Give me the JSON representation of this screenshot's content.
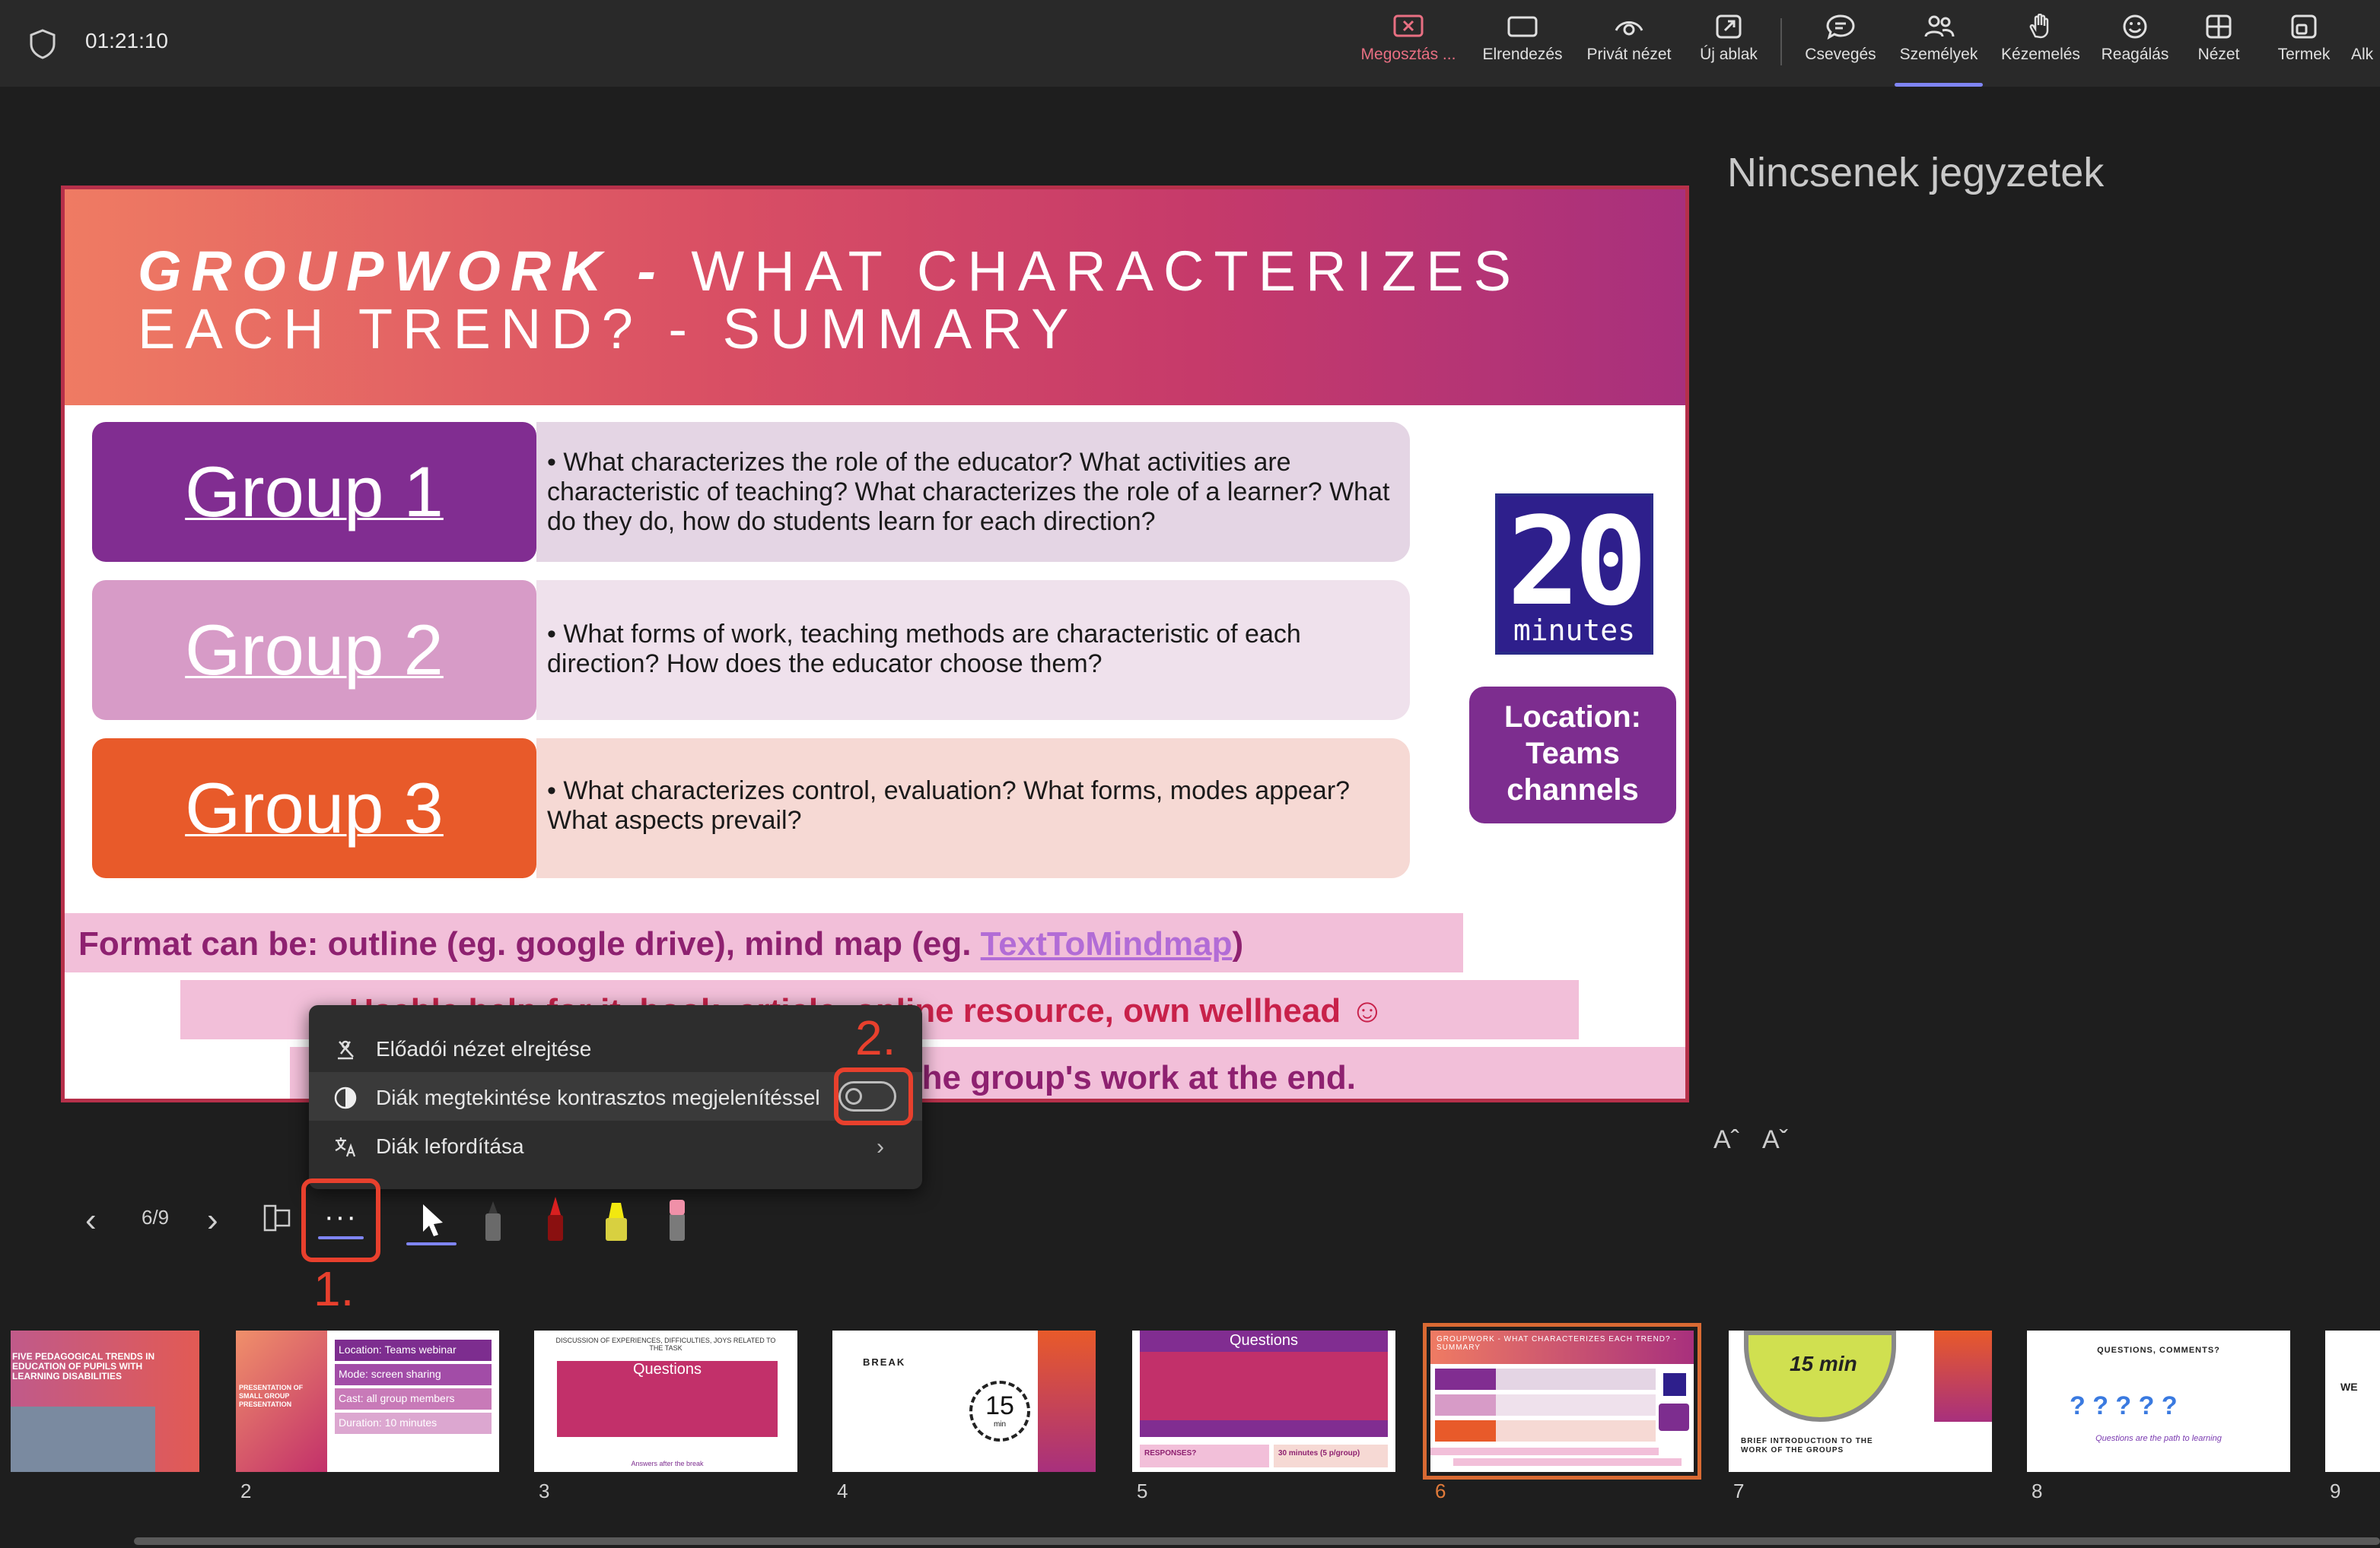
{
  "topbar": {
    "timer": "01:21:10",
    "items": [
      {
        "label": "Megosztás ..."
      },
      {
        "label": "Elrendezés"
      },
      {
        "label": "Privát nézet"
      },
      {
        "label": "Új ablak"
      },
      {
        "label": "Csevegés"
      },
      {
        "label": "Személyek"
      },
      {
        "label": "Kézemelés"
      },
      {
        "label": "Reagálás"
      },
      {
        "label": "Nézet"
      },
      {
        "label": "Termek"
      },
      {
        "label": "Alk"
      }
    ],
    "accent_color": "#7f85f5",
    "share_color": "#e86f82"
  },
  "slide": {
    "title_bold": "GROUPWORK -",
    "title_rest_line1": " WHAT CHARACTERIZES",
    "title_line2": "EACH TREND? - SUMMARY",
    "groups": [
      {
        "name": "Group 1",
        "text": "What characterizes the role of the educator? What activities are characteristic of teaching? What characterizes the role of a learner? What do they do, how do students learn for each direction?",
        "color": "#812d91",
        "bg": "#e4d5e4"
      },
      {
        "name": "Group 2",
        "text": "What forms of work, teaching methods are characteristic of each direction? How does the educator choose them?",
        "color": "#d79bc7",
        "bg": "#efe1ec"
      },
      {
        "name": "Group 3",
        "text": "What characterizes control, evaluation? What forms, modes appear? What aspects prevail?",
        "color": "#e85a2a",
        "bg": "#f6d9d4"
      }
    ],
    "badge_number": "20",
    "badge_unit": "minutes",
    "location_line1": "Location:",
    "location_line2": "Teams",
    "location_line3": "channels",
    "format_prefix": "Format can be: outline (eg. google drive), mind map (eg. ",
    "format_link": "TextToMindmap",
    "format_suffix": ")",
    "help_text": "Usable help for it, book, article, online resource, own wellhead ☺",
    "end_text": "the group's work at the end."
  },
  "notes": {
    "empty_text": "Nincsenek jegyzetek",
    "font_increase": "Aˆ",
    "font_decrease": "Aˇ"
  },
  "context_menu": {
    "items": [
      {
        "label": "Előadói nézet elrejtése",
        "icon": "presenter-hide-icon"
      },
      {
        "label": "Diák megtekintése kontrasztos megjelenítéssel",
        "icon": "contrast-icon",
        "toggle": false
      },
      {
        "label": "Diák lefordítása",
        "icon": "translate-icon",
        "submenu": true
      }
    ]
  },
  "annotations": {
    "step1": "1.",
    "step2": "2.",
    "color": "#e8402d"
  },
  "toolbar": {
    "page_indicator": "6/9",
    "tools": [
      "laser-pointer",
      "pen-black",
      "pen-red",
      "highlighter-yellow",
      "eraser-pink"
    ]
  },
  "thumbnails": [
    {
      "num": "",
      "title": "FIVE PEDAGOGICAL TRENDS IN EDUCATION OF PUPILS WITH LEARNING DISABILITIES"
    },
    {
      "num": "2",
      "title": "PRESENTATION OF SMALL GROUP PRESENTATION",
      "lines": [
        "Location: Teams webinar",
        "Mode: screen sharing",
        "Cast: all group members",
        "Duration: 10 minutes"
      ]
    },
    {
      "num": "3",
      "title": "DISCUSSION OF EXPERIENCES, DIFFICULTIES, JOYS RELATED TO THE TASK",
      "subtitle": "Questions",
      "footer": "Answers after the break"
    },
    {
      "num": "4",
      "title": "BREAK",
      "badge": "15",
      "badge_unit": "min"
    },
    {
      "num": "5",
      "title": "Questions",
      "footer_left": "RESPONSES?",
      "footer_right": "30 minutes (5 p/group)"
    },
    {
      "num": "6",
      "title": "GROUPWORK - WHAT CHARACTERIZES EACH TREND? - SUMMARY",
      "selected": true
    },
    {
      "num": "7",
      "title": "BRIEF INTRODUCTION TO THE WORK OF THE GROUPS",
      "badge": "15 min"
    },
    {
      "num": "8",
      "title": "QUESTIONS, COMMENTS?",
      "subtitle": "Questions are the path to learning"
    },
    {
      "num": "9",
      "title": "WE"
    }
  ]
}
